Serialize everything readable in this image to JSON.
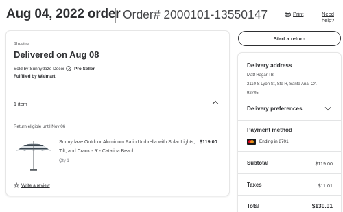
{
  "header": {
    "date_title": "Aug 04, 2022 order",
    "order_number": "Order# 2000101-13550147",
    "print_label": "Print",
    "help_label": "Need help?"
  },
  "shipment": {
    "section_label": "Shipping",
    "status": "Delivered on Aug 08",
    "sold_by_prefix": "Sold by",
    "seller": "Sunnydaze Decor",
    "seller_badge": "Pro Seller",
    "fulfilled": "Fulfilled by Walmart",
    "items_count": "1 item",
    "return_eligibility": "Return eligible until Nov 06",
    "product": {
      "title": "Sunnydaze Outdoor Aluminum Patio Umbrella with Solar Lights, Tilt, and Crank - 9' - Catalina Beach...",
      "price": "$119.00",
      "qty": "Qty 1",
      "image_icon": "striped-patio-umbrella"
    },
    "review_label": "Write a review"
  },
  "actions": {
    "start_return_label": "Start a return"
  },
  "sidebar": {
    "delivery_address_heading": "Delivery address",
    "address_name": "Matt Hagar TB",
    "address_line1": "2110 S Lyon St, Ste H, Santa Ana, CA",
    "address_zip": "92705",
    "delivery_preferences_label": "Delivery preferences",
    "payment_heading": "Payment method",
    "payment_card": "Ending in 8701",
    "subtotal_label": "Subtotal",
    "subtotal_value": "$119.00",
    "taxes_label": "Taxes",
    "taxes_value": "$11.01",
    "total_label": "Total",
    "total_value": "$130.01"
  },
  "colors": {
    "text": "#2e2f32",
    "muted": "#46474a",
    "divider": "#e3e4e5",
    "mastercard_red": "#eb001b",
    "mastercard_orange": "#f79e1b"
  }
}
